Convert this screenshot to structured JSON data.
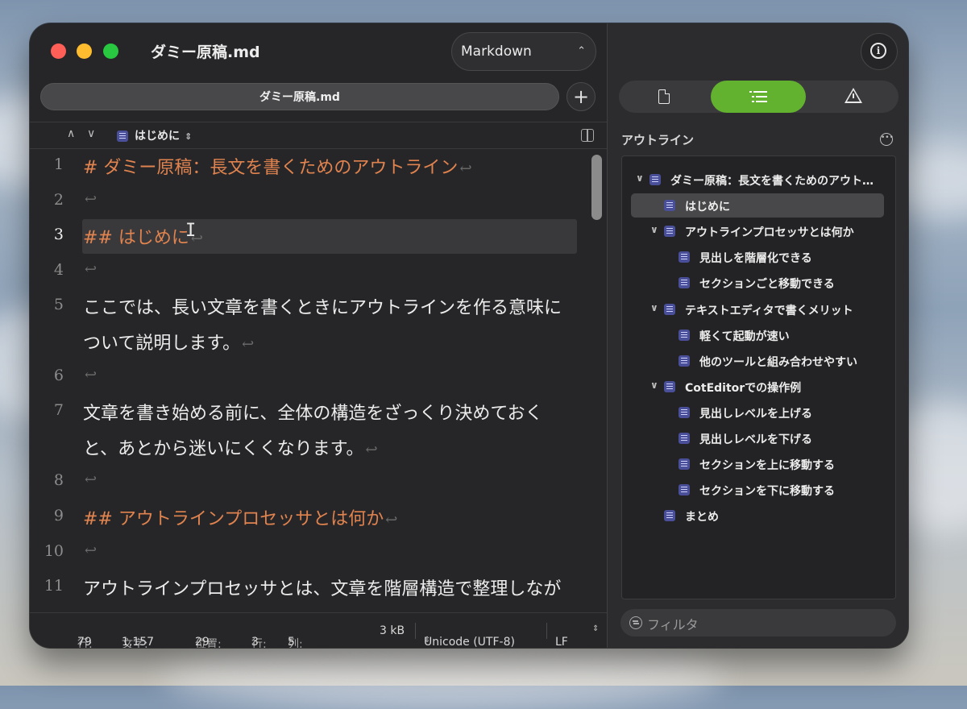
{
  "window": {
    "title": "ダミー原稿.md"
  },
  "toolbar": {
    "syntax": "Markdown"
  },
  "tab": {
    "label": "ダミー原稿.md",
    "add": "+"
  },
  "navbar": {
    "breadcrumb": "はじめに"
  },
  "editor": {
    "lines": [
      {
        "n": "1",
        "text": "# ダミー原稿：長文を書くためのアウトライン",
        "heading": true,
        "ret": "↩"
      },
      {
        "n": "2",
        "text": "",
        "heading": false,
        "ret": "↩"
      },
      {
        "n": "3",
        "text": "## はじめに",
        "heading": true,
        "ret": "↩",
        "current": true
      },
      {
        "n": "4",
        "text": "",
        "heading": false,
        "ret": "↩"
      },
      {
        "n": "5",
        "text": "ここでは、長い文章を書くときにアウトラインを作る意味に",
        "heading": false,
        "ret": ""
      },
      {
        "n": "",
        "text": "ついて説明します。",
        "heading": false,
        "ret": "↩"
      },
      {
        "n": "6",
        "text": "",
        "heading": false,
        "ret": "↩"
      },
      {
        "n": "7",
        "text": "文章を書き始める前に、全体の構造をざっくり決めておく",
        "heading": false,
        "ret": ""
      },
      {
        "n": "",
        "text": "と、あとから迷いにくくなります。",
        "heading": false,
        "ret": "↩"
      },
      {
        "n": "8",
        "text": "",
        "heading": false,
        "ret": "↩"
      },
      {
        "n": "9",
        "text": "## アウトラインプロセッサとは何か",
        "heading": true,
        "ret": "↩"
      },
      {
        "n": "10",
        "text": "",
        "heading": false,
        "ret": "↩"
      },
      {
        "n": "11",
        "text": "アウトラインプロセッサとは、文章を階層構造で整理しなが",
        "heading": false,
        "ret": ""
      }
    ]
  },
  "status": {
    "lines_label": "行:",
    "lines": "79",
    "chars_label": "文字:",
    "chars": "1,157",
    "pos_label": "位置:",
    "pos": "29",
    "row_label": "行:",
    "row": "3",
    "col_label": "列:",
    "col": "5",
    "size": "3 kB",
    "encoding": "Unicode (UTF-8)",
    "lineending": "LF"
  },
  "inspector": {
    "outline_title": "アウトライン",
    "items": [
      {
        "label": "ダミー原稿：長文を書くためのアウト…",
        "level": 0,
        "chevron": true
      },
      {
        "label": "はじめに",
        "level": 1,
        "chevron": false,
        "selected": true
      },
      {
        "label": "アウトラインプロセッサとは何か",
        "level": 1,
        "chevron": true
      },
      {
        "label": "見出しを階層化できる",
        "level": 2,
        "chevron": false
      },
      {
        "label": "セクションごと移動できる",
        "level": 2,
        "chevron": false
      },
      {
        "label": "テキストエディタで書くメリット",
        "level": 1,
        "chevron": true
      },
      {
        "label": "軽くて起動が速い",
        "level": 2,
        "chevron": false
      },
      {
        "label": "他のツールと組み合わせやすい",
        "level": 2,
        "chevron": false
      },
      {
        "label": "CotEditorでの操作例",
        "level": 1,
        "chevron": true
      },
      {
        "label": "見出しレベルを上げる",
        "level": 2,
        "chevron": false
      },
      {
        "label": "見出しレベルを下げる",
        "level": 2,
        "chevron": false
      },
      {
        "label": "セクションを上に移動する",
        "level": 2,
        "chevron": false
      },
      {
        "label": "セクションを下に移動する",
        "level": 2,
        "chevron": false
      },
      {
        "label": "まとめ",
        "level": 1,
        "chevron": false
      }
    ],
    "filter_placeholder": "フィルタ"
  },
  "colors": {
    "accent": "#62b22f",
    "heading": "#e0834f",
    "close": "#ff5f57",
    "minimize": "#febc2e",
    "zoom": "#28c840"
  }
}
